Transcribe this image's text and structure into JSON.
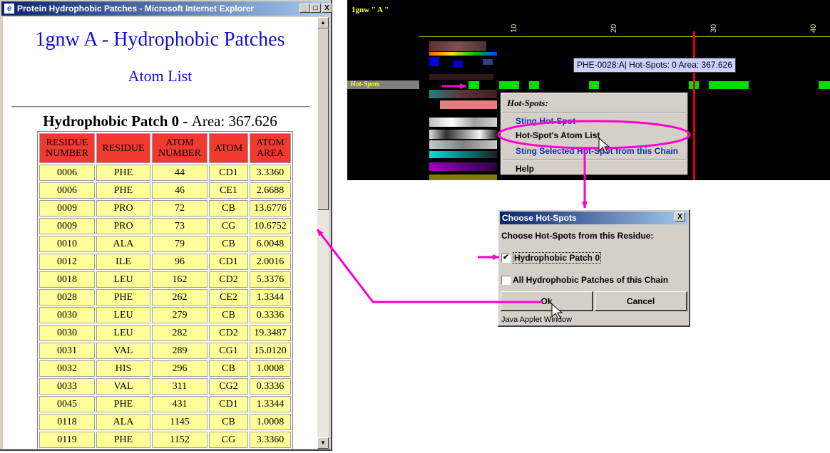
{
  "ie_window": {
    "title": "Protein Hydrophobic Patches - Microsoft Internet Explorer",
    "icon_glyph": "e",
    "buttons": [
      "_",
      "□",
      "X"
    ],
    "page_title": "1gnw A - Hydrophobic Patches",
    "page_subtitle": "Atom List",
    "patch_heading_bold": "Hydrophobic Patch 0 - ",
    "patch_heading_area": "Area: 367.626",
    "columns": [
      "RESIDUE NUMBER",
      "RESIDUE",
      "ATOM NUMBER",
      "ATOM",
      "ATOM AREA"
    ],
    "rows": [
      [
        "0006",
        "PHE",
        "44",
        "CD1",
        "3.3360"
      ],
      [
        "0006",
        "PHE",
        "46",
        "CE1",
        "2.6688"
      ],
      [
        "0009",
        "PRO",
        "72",
        "CB",
        "13.6776"
      ],
      [
        "0009",
        "PRO",
        "73",
        "CG",
        "10.6752"
      ],
      [
        "0010",
        "ALA",
        "79",
        "CB",
        "6.0048"
      ],
      [
        "0012",
        "ILE",
        "96",
        "CD1",
        "2.0016"
      ],
      [
        "0018",
        "LEU",
        "162",
        "CD2",
        "5.3376"
      ],
      [
        "0028",
        "PHE",
        "262",
        "CE2",
        "1.3344"
      ],
      [
        "0030",
        "LEU",
        "279",
        "CB",
        "0.3336"
      ],
      [
        "0030",
        "LEU",
        "282",
        "CD2",
        "19.3487"
      ],
      [
        "0031",
        "VAL",
        "289",
        "CG1",
        "15.0120"
      ],
      [
        "0032",
        "HIS",
        "296",
        "CB",
        "1.0008"
      ],
      [
        "0033",
        "VAL",
        "311",
        "CG2",
        "0.3336"
      ],
      [
        "0045",
        "PHE",
        "431",
        "CD1",
        "1.3344"
      ],
      [
        "0118",
        "ALA",
        "1145",
        "CB",
        "1.0008"
      ],
      [
        "0119",
        "PHE",
        "1152",
        "CG",
        "3.3360"
      ]
    ]
  },
  "applet": {
    "label": "1gnw \" A \"",
    "ticks": [
      "10",
      "20",
      "30",
      "40"
    ],
    "track_label": "Hot-Spots",
    "tooltip": "PHE-0028:A| Hot-Spots: 0  Area: 367.626",
    "menu": {
      "header": "Hot-Spots:",
      "items": [
        "Sting Hot-Spot",
        "Hot-Spot's Atom List",
        "Sting Selected Hot-Spot from this Chain",
        "Help"
      ]
    }
  },
  "dialog": {
    "title": "Choose Hot-Spots",
    "close": "X",
    "prompt": "Choose Hot-Spots from this Residue:",
    "option1": "Hydrophobic Patch 0",
    "option1_checked": true,
    "option2": "All Hydrophobic Patches of this Chain",
    "option2_checked": false,
    "ok": "Ok",
    "cancel": "Cancel",
    "status": "Java Applet Window"
  },
  "colors": {
    "annotation": "#ff00cc",
    "hotspot": "#00dd00",
    "header_cell": "#f03a30",
    "data_cell": "#ffff99",
    "title_blue": "#1010d0"
  }
}
